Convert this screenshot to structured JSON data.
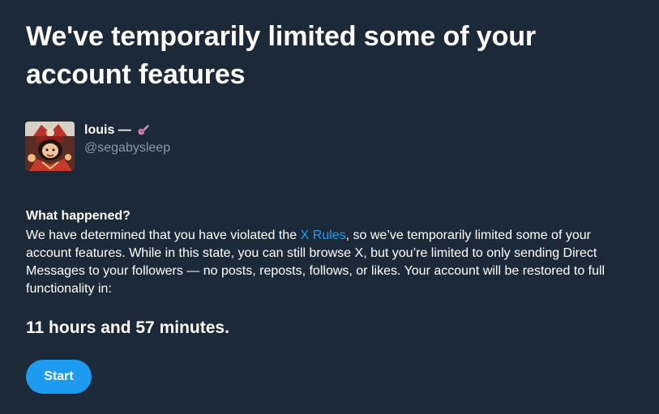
{
  "heading": {
    "title": "We've temporarily limited some of your account features"
  },
  "profile": {
    "display_name": "louis —",
    "handle": "@segabysleep",
    "emoji_icon": "guitar-icon",
    "avatar_icon": "avatar-image"
  },
  "notice": {
    "section_title": "What happened?",
    "text_before_link": "We have determined that you have violated the ",
    "link_text": "X Rules",
    "text_after_link": ", so we’ve temporarily limited some of your account features. While in this state, you can still browse X, but you’re limited to only sending Direct Messages to your followers — no posts, reposts, follows, or likes. Your account will be restored to full functionality in:",
    "countdown": "11 hours and 57 minutes."
  },
  "actions": {
    "start_label": "Start"
  },
  "colors": {
    "background": "#1c2938",
    "accent": "#1d9bf0",
    "secondary_text": "#8b98a5"
  }
}
